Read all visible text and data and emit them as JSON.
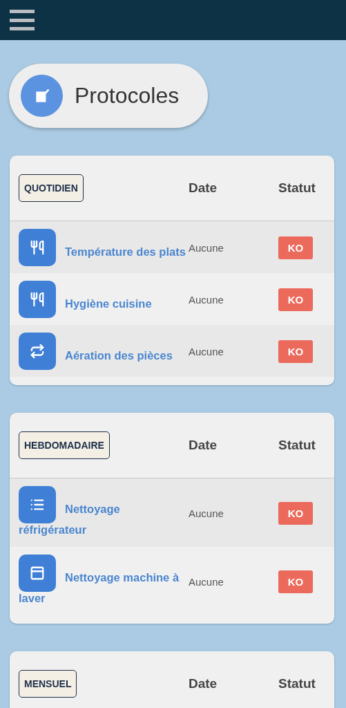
{
  "title": {
    "text": "Protocoles"
  },
  "sections": [
    {
      "label": "QUOTIDIEN",
      "columns": [
        "Date",
        "Statut"
      ],
      "rows": [
        {
          "kind": "utensils",
          "name": "Température des plats",
          "date": "Aucune",
          "status": "KO"
        },
        {
          "kind": "utensils",
          "name": "Hygiène cuisine",
          "date": "Aucune",
          "status": "KO"
        },
        {
          "kind": "repeat",
          "name": "Aération des pièces",
          "date": "Aucune",
          "status": "KO"
        }
      ]
    },
    {
      "label": "HEBDOMADAIRE",
      "columns": [
        "Date",
        "Statut"
      ],
      "rows": [
        {
          "kind": "list",
          "name": "Nettoyage réfrigérateur",
          "date": "Aucune",
          "status": "KO"
        },
        {
          "kind": "panel",
          "name": "Nettoyage machine à laver",
          "date": "Aucune",
          "status": "KO"
        }
      ]
    },
    {
      "label": "MENSUEL",
      "columns": [
        "Date",
        "Statut"
      ]
    }
  ]
}
